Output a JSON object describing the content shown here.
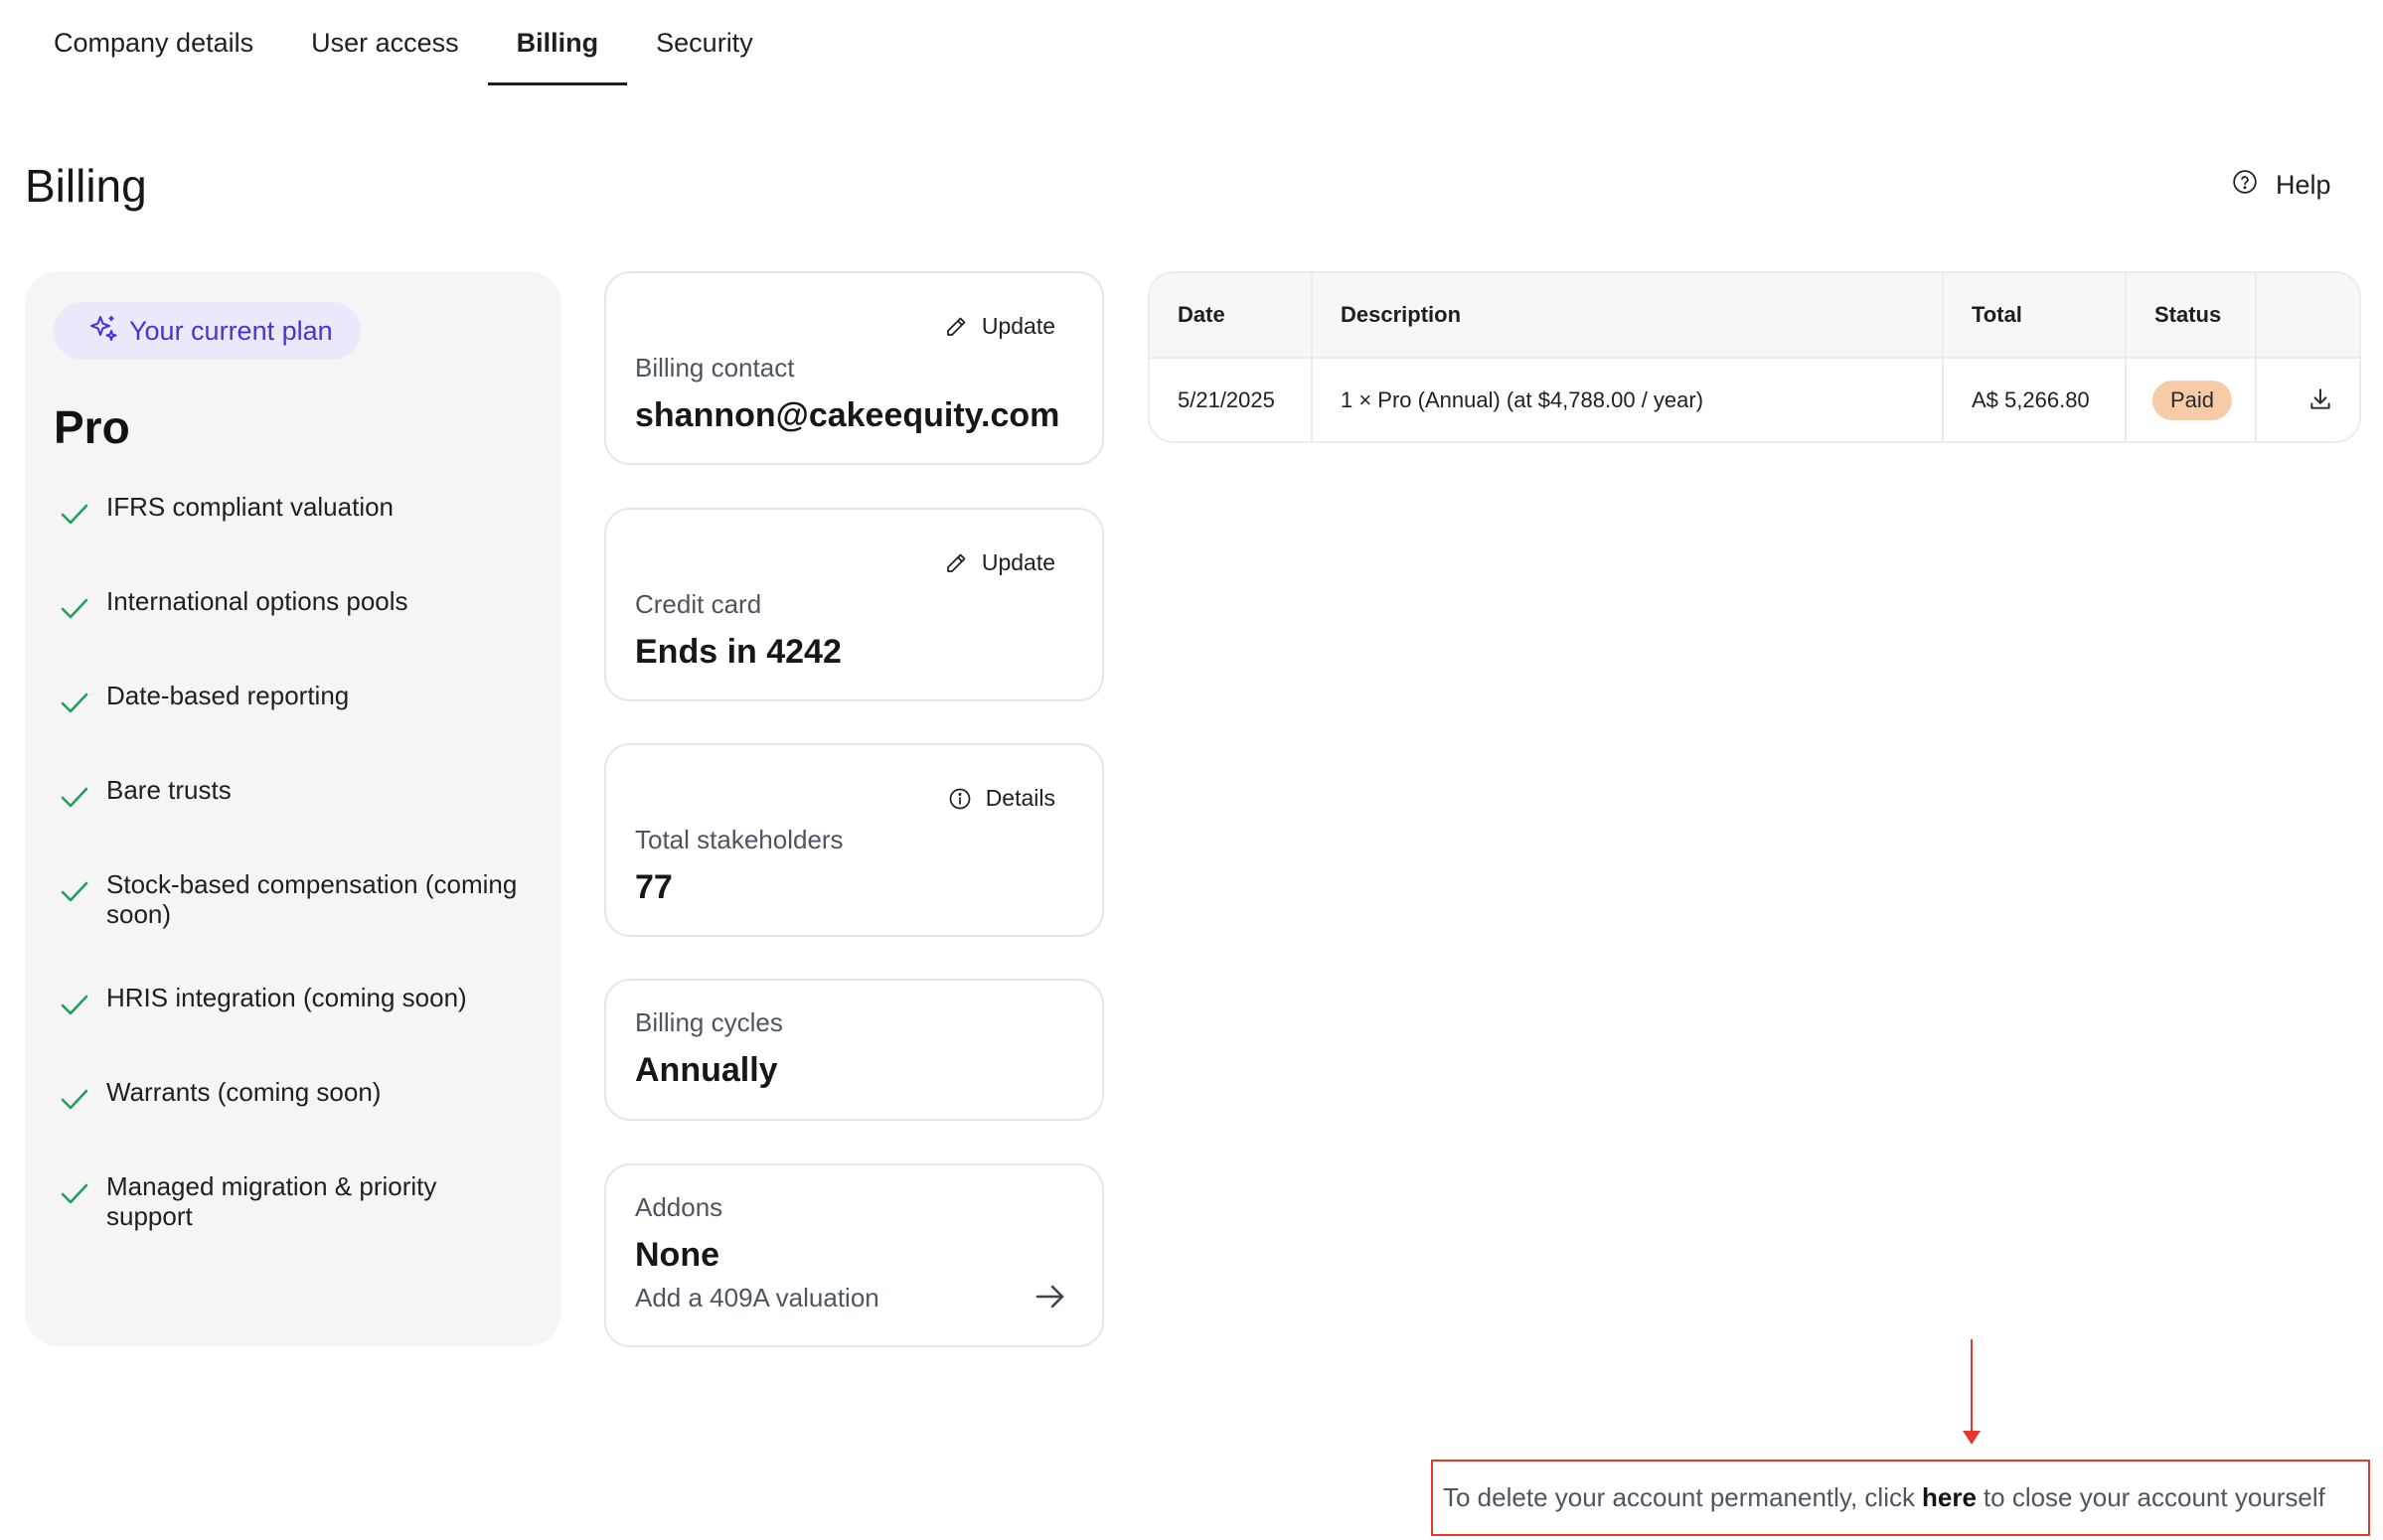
{
  "tabs": [
    {
      "label": "Company details",
      "active": false
    },
    {
      "label": "User access",
      "active": false
    },
    {
      "label": "Billing",
      "active": true
    },
    {
      "label": "Security",
      "active": false
    }
  ],
  "page": {
    "title": "Billing",
    "help_label": "Help",
    "help_icon": "question-circle-icon"
  },
  "plan": {
    "badge_label": "Your current plan",
    "badge_icon": "sparkle-icon",
    "name": "Pro",
    "features": [
      "IFRS compliant valuation",
      "International options pools",
      "Date-based reporting",
      "Bare trusts",
      "Stock-based compensation (coming soon)",
      "HRIS integration (coming soon)",
      "Warrants (coming soon)",
      "Managed migration & priority support"
    ],
    "check_color": "#22a05a"
  },
  "cards": {
    "billing_contact": {
      "action_label": "Update",
      "label": "Billing contact",
      "value": "shannon@cakeequity.com"
    },
    "credit_card": {
      "action_label": "Update",
      "label": "Credit card",
      "value": "Ends in 4242"
    },
    "stakeholders": {
      "action_label": "Details",
      "label": "Total stakeholders",
      "value": "77"
    },
    "billing_cycles": {
      "label": "Billing cycles",
      "value": "Annually"
    },
    "addons": {
      "label": "Addons",
      "value": "None",
      "link_label": "Add a 409A valuation"
    }
  },
  "invoices": {
    "columns": [
      "Date",
      "Description",
      "Total",
      "Status",
      ""
    ],
    "rows": [
      {
        "date": "5/21/2025",
        "description": "1 × Pro (Annual) (at $4,788.00 / year)",
        "total": "A$ 5,266.80",
        "status": "Paid"
      }
    ]
  },
  "delete_notice": {
    "before": "To delete your account permanently, click",
    "link": "here",
    "after": "to close your account yourself"
  },
  "colors": {
    "accent": "#4b33d1",
    "badge_bg": "#ebe8fb",
    "paid_badge": "#f6cba8",
    "annotation": "#e23b2e"
  }
}
